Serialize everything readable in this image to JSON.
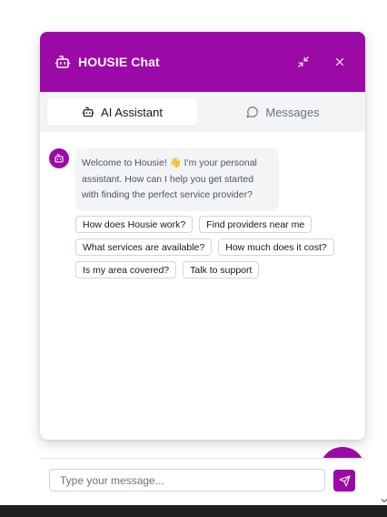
{
  "header": {
    "title": "HOUSIE Chat",
    "icon": "bot-icon",
    "minimize_icon": "minimize-icon",
    "close_icon": "close-icon",
    "color": "#9b0aa6"
  },
  "tabs": [
    {
      "label": "AI Assistant",
      "icon": "bot-icon",
      "active": true
    },
    {
      "label": "Messages",
      "icon": "message-circle-icon",
      "active": false
    }
  ],
  "message": {
    "lines": [
      "Welcome to Housie! 👋 I'm your personal",
      "assistant. How can I help you get started",
      "with finding the perfect service provider?"
    ]
  },
  "suggestions": [
    [
      "How does Housie work?",
      "Find providers near me"
    ],
    [
      "What services are available?",
      "How much does it cost?"
    ],
    [
      "Is my area covered?",
      "Talk to support"
    ]
  ],
  "input": {
    "placeholder": "Type your message...",
    "value": ""
  },
  "send_icon": "send-icon"
}
